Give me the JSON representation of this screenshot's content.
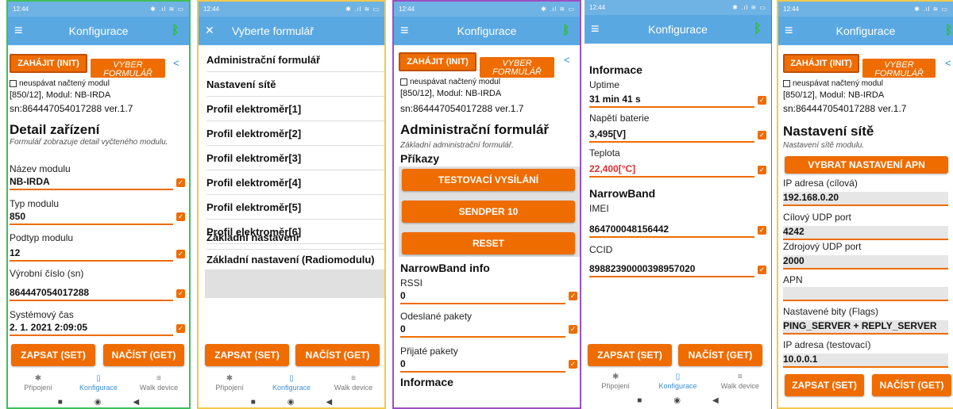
{
  "status": {
    "time": "12:44",
    "icons": "✱ .ıl ≋ ▭"
  },
  "appbar": {
    "title": "Konfigurace",
    "select_title": "Vyberte formulář"
  },
  "top": {
    "init_label": "ZAHÁJIT (INIT)",
    "vyber_label": "VYBER FORMULÁŘ",
    "nosleep_label": "neuspávat načtený modul",
    "module_line": "[850/12], Modul: NB-IRDA",
    "sn_line": "sn:864447054017288 ver.1.7"
  },
  "screen1": {
    "title": "Detail zařízení",
    "desc": "Formulář zobrazuje detail vyčteného modulu.",
    "fields": [
      {
        "label": "Název modulu",
        "value": "NB-IRDA"
      },
      {
        "label": "Typ modulu",
        "value": "850"
      },
      {
        "label": "Podtyp modulu",
        "value": "12"
      },
      {
        "label": "Výrobní číslo (sn)",
        "value": "864447054017288"
      },
      {
        "label": "Systémový čas",
        "value": "2. 1. 2021 2:09:05"
      }
    ]
  },
  "buttons": {
    "set": "ZAPSAT (SET)",
    "get": "NAČÍST (GET)"
  },
  "tabs": [
    {
      "label": "Připojení",
      "icon": "bluetooth-icon"
    },
    {
      "label": "Konfigurace",
      "icon": "device-icon"
    },
    {
      "label": "Walk device",
      "icon": "list-icon"
    }
  ],
  "screen2": {
    "items": [
      "Administrační formulář",
      "Nastavení sítě",
      "Profil elektroměr[1]",
      "Profil elektroměr[2]",
      "Profil elektroměr[3]",
      "Profil elektroměr[4]",
      "Profil elektroměr[5]",
      "Profil elektroměr[6]",
      "Základní nastavení",
      "Základní nastavení (Radiomodulu)"
    ]
  },
  "screen3": {
    "title": "Administrační formulář",
    "desc": "Základní administrační formulář.",
    "section": "Příkazy",
    "cmds": [
      "TESTOVACÍ VYSÍLÁNÍ",
      "SENDPER 10",
      "RESET"
    ],
    "nb_section": "NarrowBand info",
    "fields": [
      {
        "label": "RSSI",
        "value": "0"
      },
      {
        "label": "Odeslané pakety",
        "value": "0"
      },
      {
        "label": "Přijaté pakety",
        "value": "0"
      }
    ],
    "info": "Informace"
  },
  "screen4": {
    "info": "Informace",
    "fields": [
      {
        "label": "Uptime",
        "value": "31 min 41 s"
      },
      {
        "label": "Napětí baterie",
        "value": "3,495[V]"
      },
      {
        "label": "Teplota",
        "value": "22,400[°C]"
      }
    ],
    "nb": "NarrowBand",
    "nb_fields": [
      {
        "label": "IMEI",
        "value": "864700048156442"
      },
      {
        "label": "CCID",
        "value": "89882390000398957020"
      }
    ]
  },
  "screen5": {
    "title": "Nastavení sítě",
    "desc": "Nastavení sítě modulu.",
    "apn_button": "VYBRAT NASTAVENÍ APN",
    "fields": [
      {
        "label": "IP adresa (cílová)",
        "value": "192.168.0.20"
      },
      {
        "label": "Cílový UDP port",
        "value": "4242"
      },
      {
        "label": "Zdrojový UDP port",
        "value": "2000"
      },
      {
        "label": "APN",
        "value": ""
      },
      {
        "label": "Nastavené bity (Flags)",
        "value": "PING_SERVER + REPLY_SERVER"
      },
      {
        "label": "IP adresa (testovací)",
        "value": "10.0.0.1"
      }
    ]
  },
  "colors": {
    "green_frame": "#3fbf5a",
    "yellow_frame": "#f2c94c",
    "purple_frame": "#9b4fc4",
    "orange": "#ef6c00",
    "appbar": "#5aa8e2"
  }
}
